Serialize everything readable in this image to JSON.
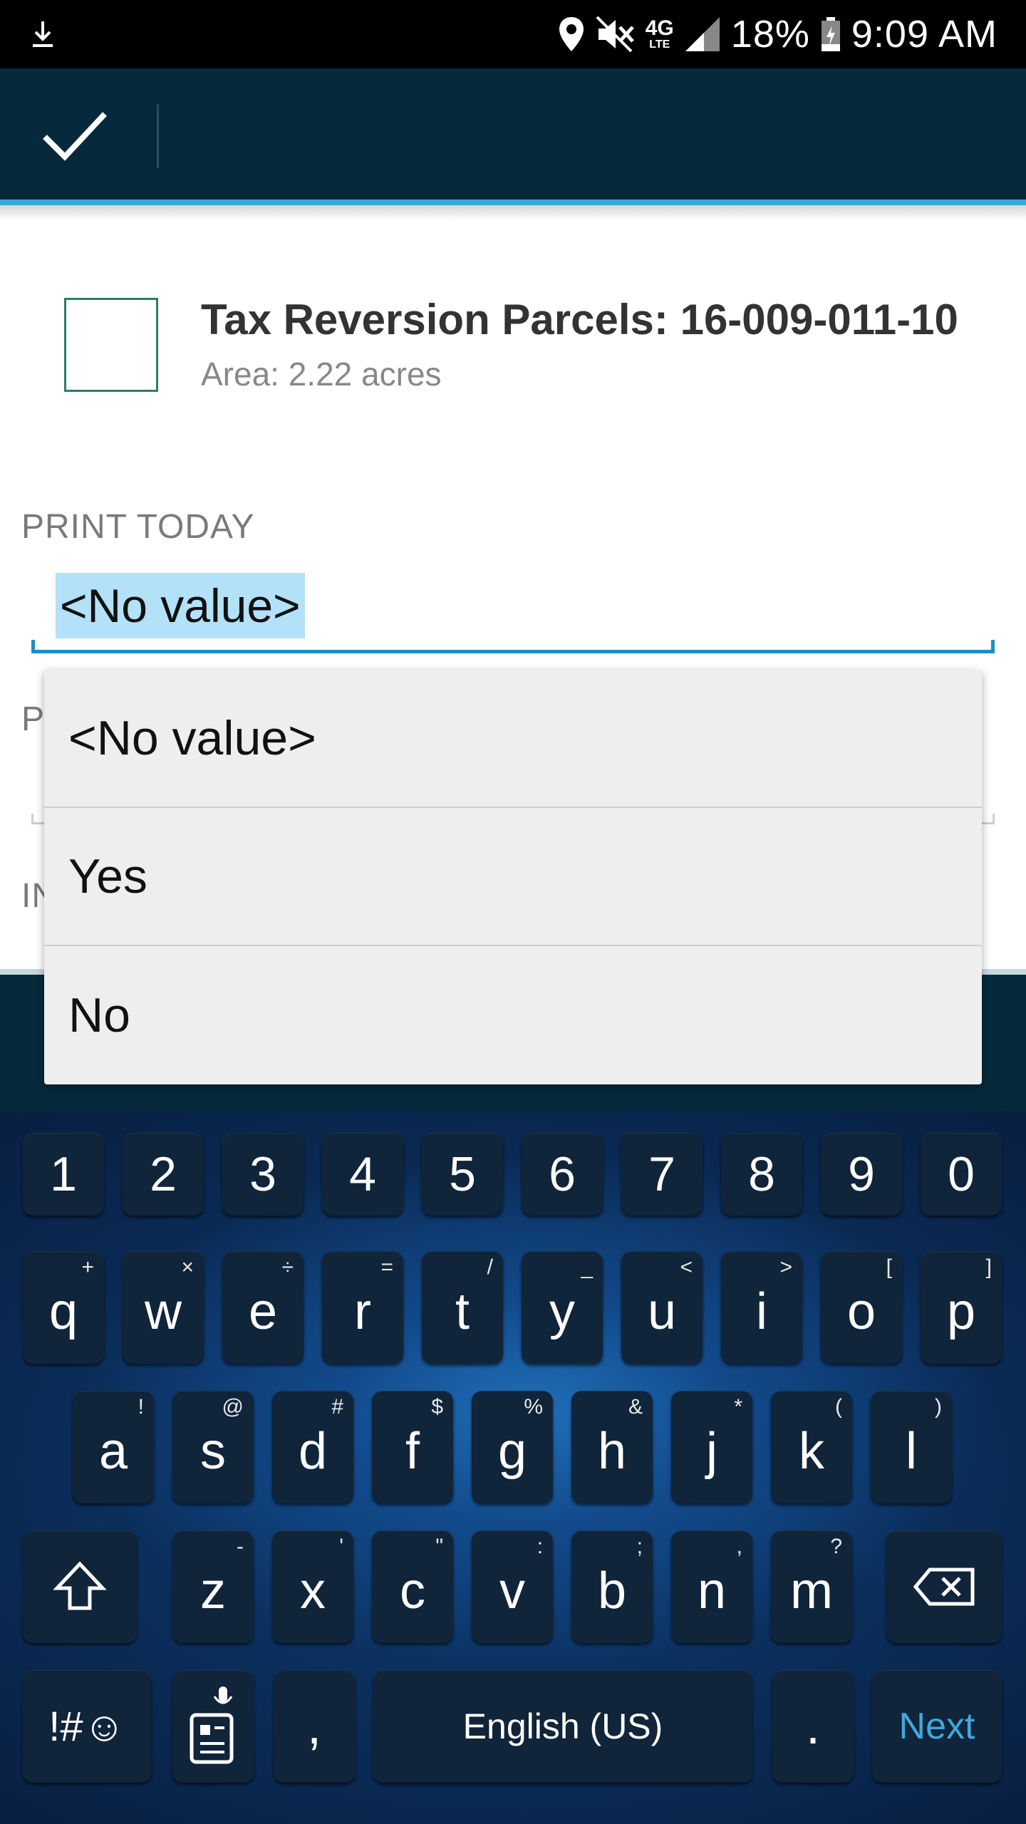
{
  "status_bar": {
    "network": "4G",
    "network_sub": "LTE",
    "battery": "18%",
    "time": "9:09 AM",
    "icons": [
      "download-icon",
      "location-icon",
      "mute-icon",
      "signal-icon",
      "battery-icon"
    ]
  },
  "action_bar": {
    "confirm_icon": "checkmark-icon"
  },
  "feature": {
    "title": "Tax Reversion Parcels: 16-009-011-10",
    "subtitle": "Area: 2.22 acres"
  },
  "form": {
    "print_today_label": "PRINT TODAY",
    "print_today_value": "<No value>",
    "second_label_partial": "P",
    "third_label_partial": "IN"
  },
  "dropdown": {
    "options": [
      "<No value>",
      "Yes",
      "No"
    ]
  },
  "keyboard": {
    "number_row": [
      "1",
      "2",
      "3",
      "4",
      "5",
      "6",
      "7",
      "8",
      "9",
      "0"
    ],
    "row1": [
      {
        "key": "q",
        "hint": "+"
      },
      {
        "key": "w",
        "hint": "×"
      },
      {
        "key": "e",
        "hint": "÷"
      },
      {
        "key": "r",
        "hint": "="
      },
      {
        "key": "t",
        "hint": "/"
      },
      {
        "key": "y",
        "hint": "_"
      },
      {
        "key": "u",
        "hint": "<"
      },
      {
        "key": "i",
        "hint": ">"
      },
      {
        "key": "o",
        "hint": "["
      },
      {
        "key": "p",
        "hint": "]"
      }
    ],
    "row2": [
      {
        "key": "a",
        "hint": "!"
      },
      {
        "key": "s",
        "hint": "@"
      },
      {
        "key": "d",
        "hint": "#"
      },
      {
        "key": "f",
        "hint": "$"
      },
      {
        "key": "g",
        "hint": "%"
      },
      {
        "key": "h",
        "hint": "&"
      },
      {
        "key": "j",
        "hint": "*"
      },
      {
        "key": "k",
        "hint": "("
      },
      {
        "key": "l",
        "hint": ")"
      }
    ],
    "row3": [
      {
        "key": "z",
        "hint": "-"
      },
      {
        "key": "x",
        "hint": "'"
      },
      {
        "key": "c",
        "hint": "\""
      },
      {
        "key": "v",
        "hint": ":"
      },
      {
        "key": "b",
        "hint": ";"
      },
      {
        "key": "n",
        "hint": ","
      },
      {
        "key": "m",
        "hint": "?"
      }
    ],
    "symbols_label": "!#☺",
    "comma": ",",
    "space_label": "English (US)",
    "period": ".",
    "next_label": "Next",
    "accent_color": "#3fa9dd"
  }
}
